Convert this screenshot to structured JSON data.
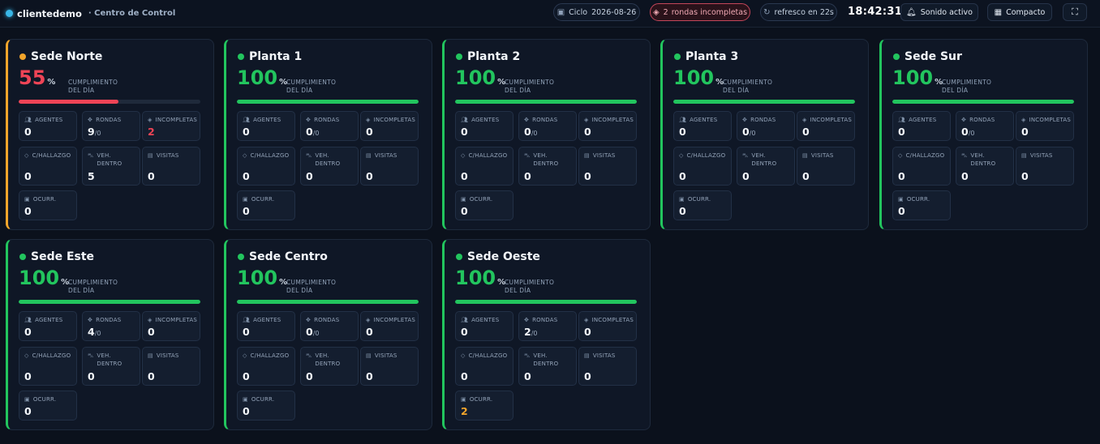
{
  "header": {
    "brand": "clientedemo",
    "subtitle": "· Centro de Control",
    "cycle_label": "Ciclo",
    "cycle_date": "2026-08-26",
    "alert_count": "2",
    "alert_text": "rondas incompletas",
    "refresh_text": "refresco en 22s",
    "clock": "18:42:31",
    "sound_label": "Sonido activo",
    "compact_label": "Compacto",
    "icons": {
      "cycle": "calendar-icon",
      "alert": "warning-diamond-icon",
      "refresh": "refresh-icon",
      "sound": "bell-icon",
      "compact": "grid-icon",
      "fullscreen": "expand-icon"
    }
  },
  "labels": {
    "compliance_line1": "CUMPLIMIENTO",
    "compliance_line2": "DEL DÍA",
    "percent_sign": "%",
    "agents": "AGENTES",
    "rounds": "RONDAS",
    "incomplete": "INCOMPLETAS",
    "findings": "C/HALLAZGO",
    "vehicles_line1": "VEH.",
    "vehicles_line2": "DENTRO",
    "visits": "VISITAS",
    "incidents": "OCURR."
  },
  "colors": {
    "ok": "#22c55e",
    "warn": "#f3a52b",
    "danger": "#ef4456",
    "accent": "#39b7e8"
  },
  "sites": [
    {
      "name": "Sede Norte",
      "status": "warn",
      "compliance": 55,
      "agents": "0",
      "rounds": "9",
      "rounds_total": "/0",
      "incomplete": "2",
      "findings": "0",
      "vehicles": "5",
      "visits": "0",
      "incidents": "0"
    },
    {
      "name": "Planta 1",
      "status": "ok",
      "compliance": 100,
      "agents": "0",
      "rounds": "0",
      "rounds_total": "/0",
      "incomplete": "0",
      "findings": "0",
      "vehicles": "0",
      "visits": "0",
      "incidents": "0"
    },
    {
      "name": "Planta 2",
      "status": "ok",
      "compliance": 100,
      "agents": "0",
      "rounds": "0",
      "rounds_total": "/0",
      "incomplete": "0",
      "findings": "0",
      "vehicles": "0",
      "visits": "0",
      "incidents": "0"
    },
    {
      "name": "Planta 3",
      "status": "ok",
      "compliance": 100,
      "agents": "0",
      "rounds": "0",
      "rounds_total": "/0",
      "incomplete": "0",
      "findings": "0",
      "vehicles": "0",
      "visits": "0",
      "incidents": "0"
    },
    {
      "name": "Sede Sur",
      "status": "ok",
      "compliance": 100,
      "agents": "0",
      "rounds": "0",
      "rounds_total": "/0",
      "incomplete": "0",
      "findings": "0",
      "vehicles": "0",
      "visits": "0",
      "incidents": "0"
    },
    {
      "name": "Sede Este",
      "status": "ok",
      "compliance": 100,
      "agents": "0",
      "rounds": "4",
      "rounds_total": "/0",
      "incomplete": "0",
      "findings": "0",
      "vehicles": "0",
      "visits": "0",
      "incidents": "0"
    },
    {
      "name": "Sede Centro",
      "status": "ok",
      "compliance": 100,
      "agents": "0",
      "rounds": "0",
      "rounds_total": "/0",
      "incomplete": "0",
      "findings": "0",
      "vehicles": "0",
      "visits": "0",
      "incidents": "0"
    },
    {
      "name": "Sede Oeste",
      "status": "ok",
      "compliance": 100,
      "agents": "0",
      "rounds": "2",
      "rounds_total": "/0",
      "incomplete": "0",
      "findings": "0",
      "vehicles": "0",
      "visits": "0",
      "incidents": "2"
    }
  ]
}
